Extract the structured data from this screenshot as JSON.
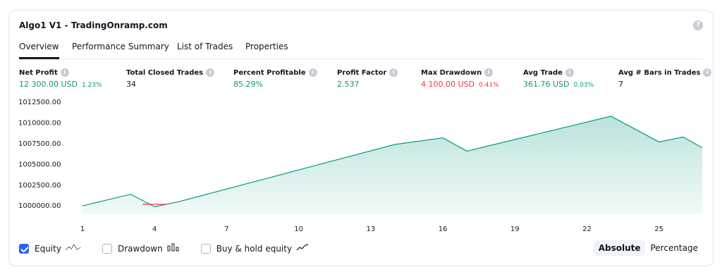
{
  "header": {
    "title": "Algo1 V1 - TradingOnramp.com",
    "help_icon": "question-icon"
  },
  "tabs": [
    {
      "label": "Overview",
      "active": true
    },
    {
      "label": "Performance Summary"
    },
    {
      "label": "List of Trades"
    },
    {
      "label": "Properties"
    }
  ],
  "metrics": [
    {
      "label": "Net Profit",
      "value": "12 300.00 USD",
      "sub": "1.23%",
      "color": "green"
    },
    {
      "label": "Total Closed Trades",
      "value": "34",
      "sub": "",
      "color": "dark"
    },
    {
      "label": "Percent Profitable",
      "value": "85.29%",
      "sub": "",
      "color": "green"
    },
    {
      "label": "Profit Factor",
      "value": "2.537",
      "sub": "",
      "color": "green"
    },
    {
      "label": "Max Drawdown",
      "value": "4 100.00 USD",
      "sub": "0.41%",
      "color": "red"
    },
    {
      "label": "Avg Trade",
      "value": "361.76 USD",
      "sub": "0.03%",
      "color": "green"
    },
    {
      "label": "Avg # Bars in Trades",
      "value": "7",
      "sub": "",
      "color": "dark"
    }
  ],
  "chart_data": {
    "type": "area",
    "y_ticks": [
      "1012500.00",
      "1010000.00",
      "1007500.00",
      "1005000.00",
      "1002500.00",
      "1000000.00"
    ],
    "x_ticks": [
      "1",
      "4",
      "7",
      "10",
      "13",
      "16",
      "19",
      "22",
      "25"
    ],
    "ylim": [
      999000,
      1013000
    ],
    "xlim": [
      0.5,
      26.8
    ],
    "series": [
      {
        "color": "#089981",
        "x": [
          1,
          3,
          4,
          5,
          8,
          11,
          14,
          16,
          17,
          20,
          23,
          25,
          26,
          26.8
        ],
        "values": [
          1000000,
          1001400,
          999900,
          1000500,
          1002800,
          1005100,
          1007400,
          1008200,
          1006600,
          1008700,
          1010800,
          1007700,
          1008300,
          1007000
        ]
      }
    ],
    "drawdown_segment": {
      "x": [
        3.5,
        4.5
      ],
      "color": "#f23645"
    }
  },
  "legend": [
    {
      "label": "Equity",
      "checked": true,
      "icon": "equity-line-icon"
    },
    {
      "label": "Drawdown",
      "checked": false,
      "icon": "drawdown-bars-icon"
    },
    {
      "label": "Buy & hold equity",
      "checked": false,
      "icon": "buy-hold-line-icon"
    }
  ],
  "toggle": {
    "absolute": "Absolute",
    "percentage": "Percentage"
  }
}
